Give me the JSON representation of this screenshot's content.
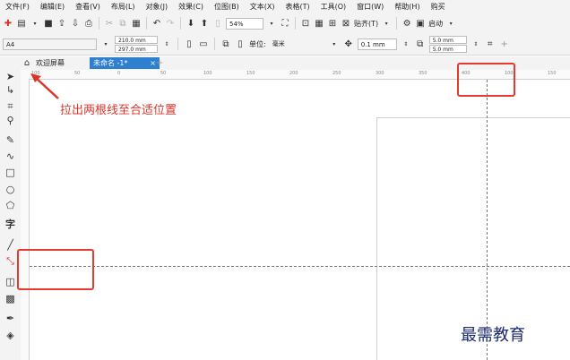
{
  "menu": [
    "文件(F)",
    "编辑(E)",
    "查看(V)",
    "布局(L)",
    "对象(J)",
    "效果(C)",
    "位图(B)",
    "文本(X)",
    "表格(T)",
    "工具(O)",
    "窗口(W)",
    "帮助(H)",
    "购买"
  ],
  "toolbar1": {
    "zoom": "54%",
    "snap_label": "贴齐(T)",
    "launch_label": "启动"
  },
  "toolbar2": {
    "page_size": "A4",
    "width": "210.0 mm",
    "height": "297.0 mm",
    "unit_label": "单位:",
    "unit_value": "毫米",
    "nudge": "0.1 mm",
    "dup_x": "5.0 mm",
    "dup_y": "5.0 mm"
  },
  "tabs": {
    "welcome": "欢迎屏幕",
    "doc": "未命名 -1*"
  },
  "ruler": {
    "h": [
      "100",
      "50",
      "0",
      "50",
      "100",
      "150",
      "200",
      "250",
      "300",
      "350",
      "400",
      "100",
      "150"
    ]
  },
  "annotation": "拉出两根线至合适位置",
  "watermark": "最需教育",
  "colors": {
    "annotation": "#d9352b",
    "guide": "#7a7a7a",
    "accent": "#2f7fd1"
  }
}
